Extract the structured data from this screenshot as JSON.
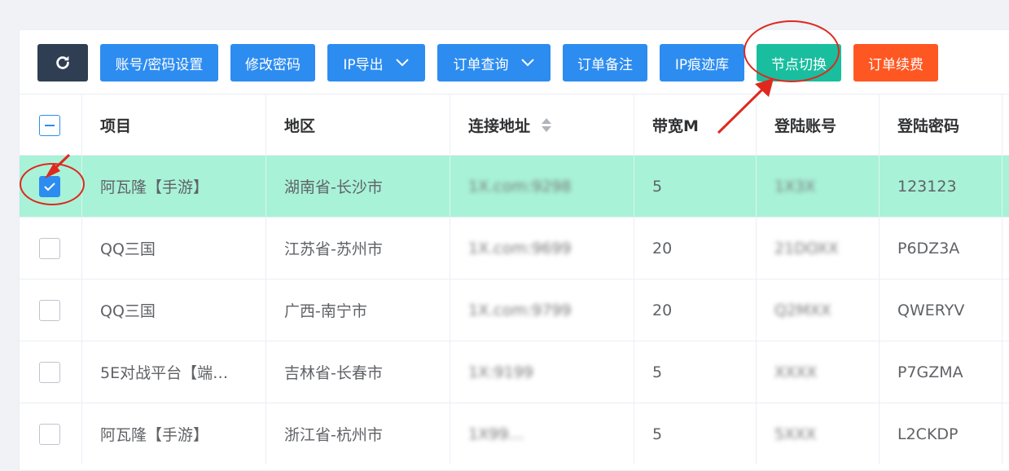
{
  "toolbar": {
    "buttons": [
      {
        "label": "",
        "icon": "refresh-icon",
        "color": "#2f3e52"
      },
      {
        "label": "账号/密码设置",
        "color": "#2d8cf0"
      },
      {
        "label": "修改密码",
        "color": "#2d8cf0"
      },
      {
        "label": "IP导出",
        "color": "#2d8cf0",
        "dropdown": true
      },
      {
        "label": "订单查询",
        "color": "#2d8cf0",
        "dropdown": true
      },
      {
        "label": "订单备注",
        "color": "#2d8cf0"
      },
      {
        "label": "IP痕迹库",
        "color": "#2d8cf0"
      },
      {
        "label": "节点切换",
        "color": "#19be9f"
      },
      {
        "label": "订单续费",
        "color": "#ff5722"
      }
    ]
  },
  "table": {
    "headers": {
      "project": "项目",
      "region": "地区",
      "address": "连接地址",
      "bandwidth": "带宽M",
      "account": "登陆账号",
      "password": "登陆密码"
    },
    "header_checkbox_state": "indeterminate",
    "rows": [
      {
        "checked": true,
        "project": "阿瓦隆【手游】",
        "region": "湖南省-长沙市",
        "address": "1X.com:9298",
        "bandwidth": "5",
        "account": "1X3X",
        "password": "123123"
      },
      {
        "checked": false,
        "project": "QQ三国",
        "region": "江苏省-苏州市",
        "address": "1X.com:9699",
        "bandwidth": "20",
        "account": "21DOXX",
        "password": "P6DZ3A"
      },
      {
        "checked": false,
        "project": "QQ三国",
        "region": "广西-南宁市",
        "address": "1X.com:9799",
        "bandwidth": "20",
        "account": "Q2MXX",
        "password": "QWERYV"
      },
      {
        "checked": false,
        "project": "5E对战平台【端…",
        "region": "吉林省-长春市",
        "address": "1X:9199",
        "bandwidth": "5",
        "account": "XXXX",
        "password": "P7GZMA"
      },
      {
        "checked": false,
        "project": "阿瓦隆【手游】",
        "region": "浙江省-杭州市",
        "address": "1X99…",
        "bandwidth": "5",
        "account": "5XXX",
        "password": "L2CKDP"
      }
    ]
  },
  "colors": {
    "selected_row": "#a8f2d8",
    "primary": "#2d8cf0",
    "annotation": "#e0281e"
  }
}
